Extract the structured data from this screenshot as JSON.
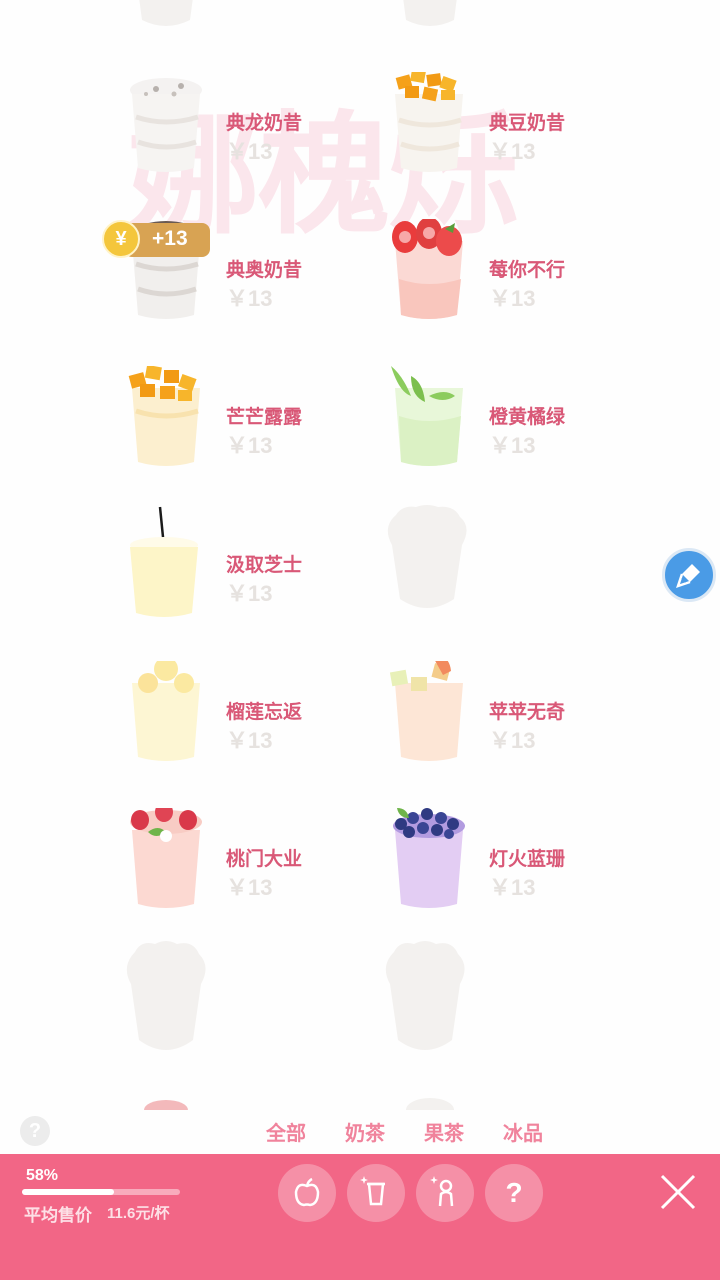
{
  "watermark": "娜槐烁",
  "menu": {
    "items": [
      {
        "name": "典龙奶昔",
        "price": "￥13",
        "cup": "oreo-milkshake"
      },
      {
        "name": "典豆奶昔",
        "price": "￥13",
        "cup": "mango-milkshake"
      },
      {
        "name": "典奥奶昔",
        "price": "￥13",
        "cup": "oreo-milkshake"
      },
      {
        "name": "莓你不行",
        "price": "￥13",
        "cup": "strawberry-tea"
      },
      {
        "name": "芒芒露露",
        "price": "￥13",
        "cup": "mango-tea"
      },
      {
        "name": "橙黄橘绿",
        "price": "￥13",
        "cup": "green-tea"
      },
      {
        "name": "汲取芝士",
        "price": "￥13",
        "cup": "cheese-drink"
      },
      {
        "name": "榴莲忘返",
        "price": "￥13",
        "cup": "durian-drink"
      },
      {
        "name": "苹苹无奇",
        "price": "￥13",
        "cup": "apple-tea"
      },
      {
        "name": "桃门大业",
        "price": "￥13",
        "cup": "peach-tea"
      },
      {
        "name": "灯火蓝珊",
        "price": "￥13",
        "cup": "blueberry-tea"
      }
    ]
  },
  "coin_popup": {
    "symbol": "¥",
    "amount": "+13"
  },
  "filters": [
    "全部",
    "奶茶",
    "果茶",
    "冰品"
  ],
  "stats": {
    "percent_label": "58%",
    "progress": 0.58,
    "avg_label": "平均售价",
    "avg_value": "11.6元/杯"
  },
  "toolbar": {
    "help_symbol": "?",
    "small_help_symbol": "?"
  },
  "icons": {
    "fruit": "apple-icon",
    "cup": "cup-sparkle-icon",
    "person": "person-sparkle-icon",
    "help": "question-icon",
    "close": "close-icon",
    "broom": "broom-icon"
  },
  "colors": {
    "accent": "#f26686",
    "name_pink": "#d95877",
    "price_gray": "#e6e2df",
    "coin": "#f4c63c",
    "float_blue": "#4a9be6"
  }
}
